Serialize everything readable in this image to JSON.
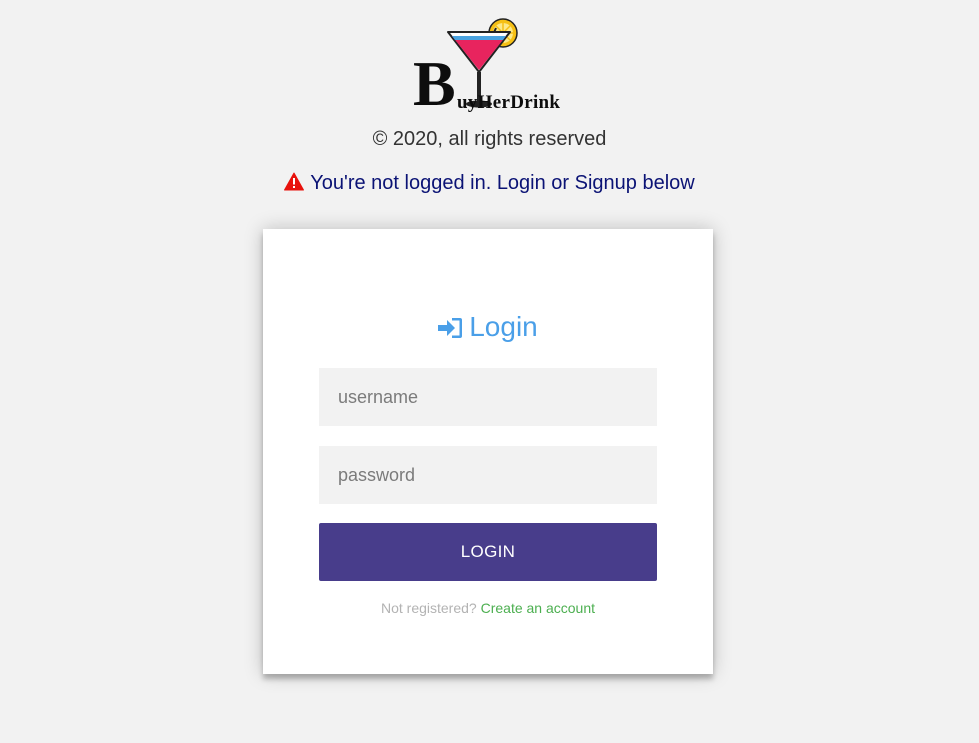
{
  "logo": {
    "big_letter": "B",
    "rest_text": "uyHerDrink",
    "icon": "cocktail-glass-icon"
  },
  "copyright": "© 2020, all rights reserved",
  "alert": {
    "icon": "warning-triangle-icon",
    "text": "You're not logged in. Login or Signup below",
    "icon_color": "#e8120c",
    "text_color": "#0b1375"
  },
  "login_card": {
    "title": "Login",
    "title_icon": "sign-in-icon",
    "title_color": "#4a9fe8",
    "username": {
      "placeholder": "username",
      "value": ""
    },
    "password": {
      "placeholder": "password",
      "value": ""
    },
    "submit_label": "LOGIN",
    "submit_color": "#483d8b",
    "register_prompt": "Not registered?",
    "register_link": "Create an account",
    "register_link_color": "#4caf50"
  }
}
